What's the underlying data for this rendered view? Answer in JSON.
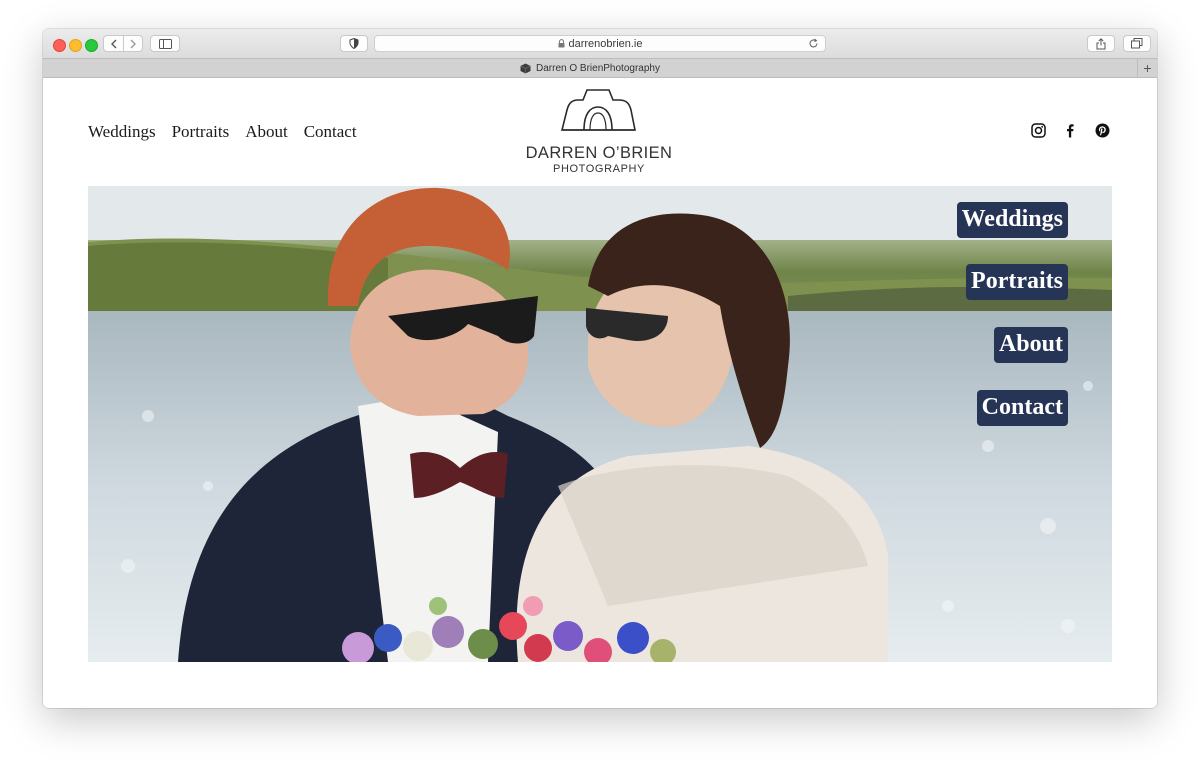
{
  "browser": {
    "url": "darrenobrien.ie",
    "tab_title": "Darren O BrienPhotography",
    "new_tab_glyph": "+",
    "accent_traffic_lights": [
      "#fe5f57",
      "#febc2e",
      "#28c840"
    ]
  },
  "site": {
    "nav": [
      "Weddings",
      "Portraits",
      "About",
      "Contact"
    ],
    "logo": {
      "name": "DARREN O’BRIEN",
      "subtitle": "PHOTOGRAPHY"
    },
    "social_icons": [
      "instagram-icon",
      "facebook-icon",
      "pinterest-icon"
    ]
  },
  "hero": {
    "buttons": [
      "Weddings",
      "Portraits",
      "About",
      "Contact"
    ],
    "button_color": "#263456"
  }
}
